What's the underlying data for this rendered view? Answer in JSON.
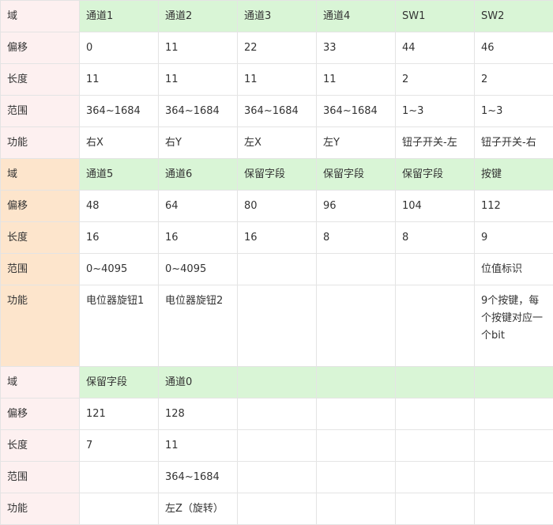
{
  "sections": [
    {
      "id": "section-1",
      "label_style": "pink",
      "rows": [
        {
          "key": "header",
          "label": "域",
          "cells": [
            "通道1",
            "通道2",
            "通道3",
            "通道4",
            "SW1",
            "SW2"
          ]
        },
        {
          "key": "offset",
          "label": "偏移",
          "cells": [
            "0",
            "11",
            "22",
            "33",
            "44",
            "46"
          ]
        },
        {
          "key": "length",
          "label": "长度",
          "cells": [
            "11",
            "11",
            "11",
            "11",
            "2",
            "2"
          ]
        },
        {
          "key": "range",
          "label": "范围",
          "cells": [
            "364~1684",
            "364~1684",
            "364~1684",
            "364~1684",
            "1~3",
            "1~3"
          ]
        },
        {
          "key": "function",
          "label": "功能",
          "cells": [
            "右X",
            "右Y",
            "左X",
            "左Y",
            "钮子开关-左",
            "钮子开关-右"
          ]
        }
      ]
    },
    {
      "id": "section-2",
      "label_style": "orange",
      "rows": [
        {
          "key": "header",
          "label": "域",
          "cells": [
            "通道5",
            "通道6",
            "保留字段",
            "保留字段",
            "保留字段",
            "按键"
          ]
        },
        {
          "key": "offset",
          "label": "偏移",
          "cells": [
            "48",
            "64",
            "80",
            "96",
            "104",
            "112"
          ]
        },
        {
          "key": "length",
          "label": "长度",
          "cells": [
            "16",
            "16",
            "16",
            "8",
            "8",
            "9"
          ]
        },
        {
          "key": "range",
          "label": "范围",
          "cells": [
            "0~4095",
            "0~4095",
            "",
            "",
            "",
            "位值标识"
          ]
        },
        {
          "key": "function",
          "label": "功能",
          "cells": [
            "电位器旋钮1",
            "电位器旋钮2",
            "",
            "",
            "",
            "9个按键，每个按键对应一个bit"
          ]
        }
      ]
    },
    {
      "id": "section-3",
      "label_style": "pink",
      "rows": [
        {
          "key": "header",
          "label": "域",
          "cells": [
            "保留字段",
            "通道0",
            "",
            "",
            "",
            ""
          ]
        },
        {
          "key": "offset",
          "label": "偏移",
          "cells": [
            "121",
            "128",
            "",
            "",
            "",
            ""
          ]
        },
        {
          "key": "length",
          "label": "长度",
          "cells": [
            "7",
            "11",
            "",
            "",
            "",
            ""
          ]
        },
        {
          "key": "range",
          "label": "范围",
          "cells": [
            "",
            "364~1684",
            "",
            "",
            "",
            ""
          ]
        },
        {
          "key": "function",
          "label": "功能",
          "cells": [
            "",
            "左Z（旋转）",
            "",
            "",
            "",
            ""
          ]
        }
      ]
    }
  ],
  "colors": {
    "header_green": "#d9f5d6",
    "label_pink": "#fdf0f0",
    "label_orange": "#fde5cc",
    "border": "#e4e4e4",
    "text": "#333333"
  }
}
